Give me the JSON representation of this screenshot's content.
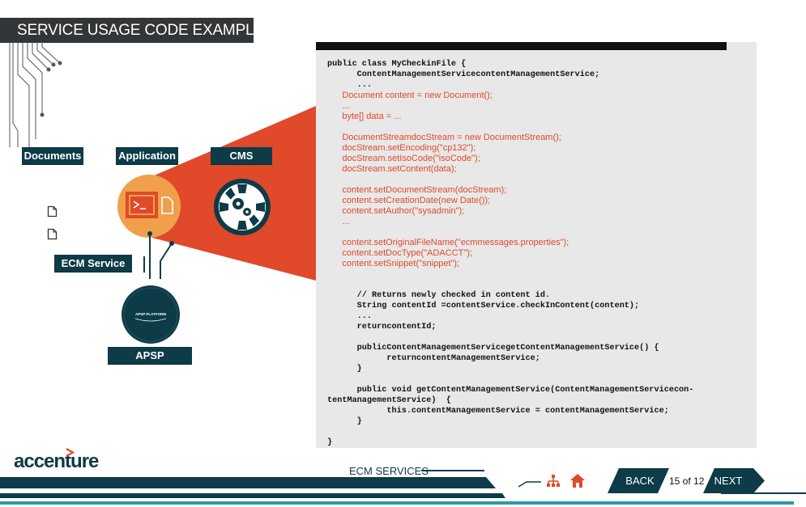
{
  "header": {
    "title": "SERVICE USAGE CODE EXAMPLE"
  },
  "diagram": {
    "labels": {
      "documents": "Documents",
      "application": "Application",
      "cms": "CMS",
      "ecm_service": "ECM Service",
      "apsp_platform": "APSP PLATFORM"
    },
    "badge_text": "APSP PLATFORM",
    "colors": {
      "accent": "#e0492a",
      "navy": "#0d3b47",
      "orange": "#f0a04b"
    }
  },
  "code": {
    "lines": [
      {
        "text": "public class MyCheckinFile {",
        "red": false
      },
      {
        "text": "      ContentManagementServicecontentManagementService;",
        "red": false
      },
      {
        "text": "      ...",
        "red": false
      },
      {
        "text": "      Document content = new Document();",
        "red": true
      },
      {
        "text": "      ...",
        "red": true
      },
      {
        "text": "      byte[] data = ...",
        "red": true
      },
      {
        "text": "",
        "red": false
      },
      {
        "text": "      DocumentStreamdocStream = new DocumentStream();",
        "red": true
      },
      {
        "text": "      docStream.setEncoding(\"cp132\");",
        "red": true
      },
      {
        "text": "      docStream.setIsoCode(\"isoCode\");",
        "red": true
      },
      {
        "text": "      docStream.setContent(data);",
        "red": true
      },
      {
        "text": "",
        "red": false
      },
      {
        "text": "      content.setDocumentStream(docStream);",
        "red": true
      },
      {
        "text": "      content.setCreationDate(new Date());",
        "red": true
      },
      {
        "text": "      content.setAuthor(\"sysadmin\");",
        "red": true
      },
      {
        "text": "      ...",
        "red": true
      },
      {
        "text": "",
        "red": false
      },
      {
        "text": "      content.setOriginalFileName(\"ecmmessages.properties\");",
        "red": true
      },
      {
        "text": "      content.setDocType(\"ADACCT\");",
        "red": true
      },
      {
        "text": "      content.setSnippet(\"snippet\");",
        "red": true
      },
      {
        "text": "",
        "red": false
      },
      {
        "text": "",
        "red": false
      },
      {
        "text": "      // Returns newly checked in content id.",
        "red": false
      },
      {
        "text": "      String contentId =contentService.checkInContent(content);",
        "red": false
      },
      {
        "text": "      ...",
        "red": false
      },
      {
        "text": "      returncontentId;",
        "red": false
      },
      {
        "text": "",
        "red": false
      },
      {
        "text": "      publicContentManagementServicegetContentManagementService() {",
        "red": false
      },
      {
        "text": "            returncontentManagementService;",
        "red": false
      },
      {
        "text": "      }",
        "red": false
      },
      {
        "text": "",
        "red": false
      },
      {
        "text": "      public void getContentManagementService(ContentManagementServicecon-",
        "red": false
      },
      {
        "text": "tentManagementService)  {",
        "red": false
      },
      {
        "text": "            this.contentManagementService = contentManagementService;",
        "red": false
      },
      {
        "text": "      }",
        "red": false
      },
      {
        "text": "",
        "red": false
      },
      {
        "text": "}",
        "red": false
      }
    ]
  },
  "footer": {
    "logo": "accenture",
    "section": "ECM SERVICES",
    "back_label": "BACK",
    "page_indicator": "15 of 12",
    "next_label": "NEXT"
  }
}
